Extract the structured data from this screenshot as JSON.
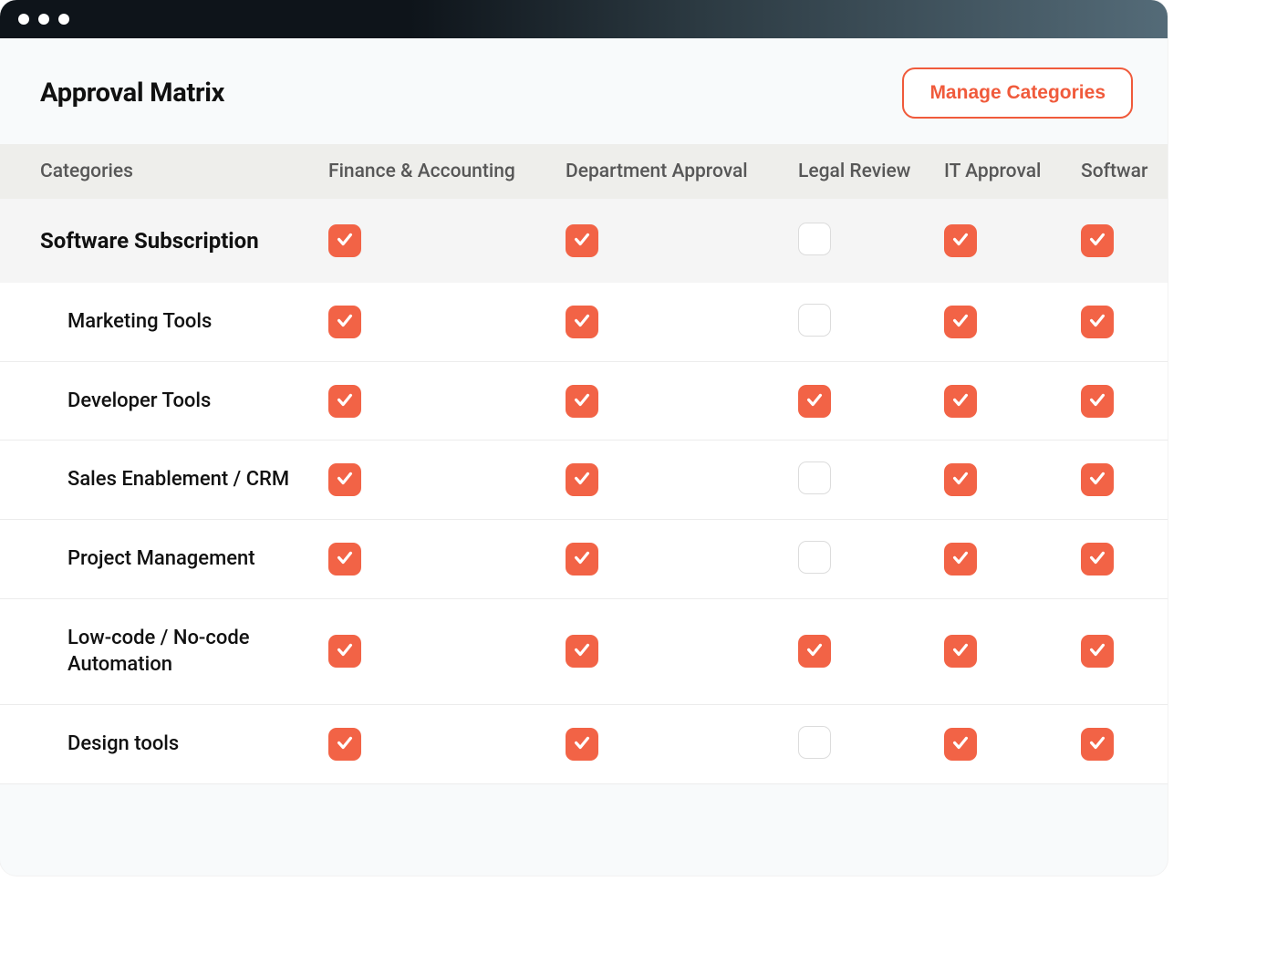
{
  "header": {
    "title": "Approval Matrix",
    "manage_button": "Manage Categories"
  },
  "columns": {
    "categories": "Categories",
    "finance": "Finance & Accounting",
    "department": "Department Approval",
    "legal": "Legal Review",
    "it": "IT Approval",
    "software": "Softwar"
  },
  "section": {
    "name": "Software Subscription",
    "checks": {
      "finance": true,
      "department": true,
      "legal": false,
      "it": true,
      "software": true
    }
  },
  "rows": [
    {
      "name": "Marketing Tools",
      "checks": {
        "finance": true,
        "department": true,
        "legal": false,
        "it": true,
        "software": true
      }
    },
    {
      "name": "Developer Tools",
      "checks": {
        "finance": true,
        "department": true,
        "legal": true,
        "it": true,
        "software": true
      }
    },
    {
      "name": "Sales Enablement / CRM",
      "checks": {
        "finance": true,
        "department": true,
        "legal": false,
        "it": true,
        "software": true
      }
    },
    {
      "name": "Project Management",
      "checks": {
        "finance": true,
        "department": true,
        "legal": false,
        "it": true,
        "software": true
      }
    },
    {
      "name": "Low-code / No-code Automation",
      "checks": {
        "finance": true,
        "department": true,
        "legal": true,
        "it": true,
        "software": true
      }
    },
    {
      "name": "Design tools",
      "checks": {
        "finance": true,
        "department": true,
        "legal": false,
        "it": true,
        "software": true
      }
    }
  ],
  "colors": {
    "accent": "#f05a3b",
    "checkbox": "#f26346"
  }
}
